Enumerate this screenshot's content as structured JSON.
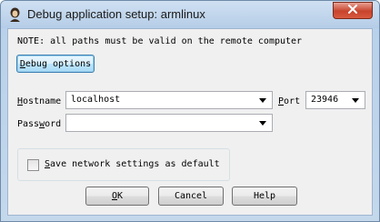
{
  "window": {
    "title": "Debug application setup: armlinux",
    "icon": "ida-app-icon",
    "close_icon": "close-icon"
  },
  "note": "NOTE: all paths must be valid on the remote computer",
  "debug_options_button": {
    "accel": "D",
    "rest": "ebug options"
  },
  "hostname": {
    "label_accel": "H",
    "label_rest": "ostname",
    "value": "localhost"
  },
  "port": {
    "label_accel": "P",
    "label_rest": "ort",
    "value": "23946"
  },
  "password": {
    "label_accel": "",
    "label_pre": "Pass",
    "label_u": "w",
    "label_post": "ord",
    "value": ""
  },
  "save_checkbox": {
    "accel": "S",
    "rest": "ave network settings as default",
    "checked": false
  },
  "buttons": {
    "ok": {
      "accel": "O",
      "rest": "K"
    },
    "cancel": "Cancel",
    "help": "Help"
  },
  "colors": {
    "titlebar": "#b9d1ea",
    "close_button": "#c7432b",
    "dialog_face": "#f0f0f0"
  }
}
